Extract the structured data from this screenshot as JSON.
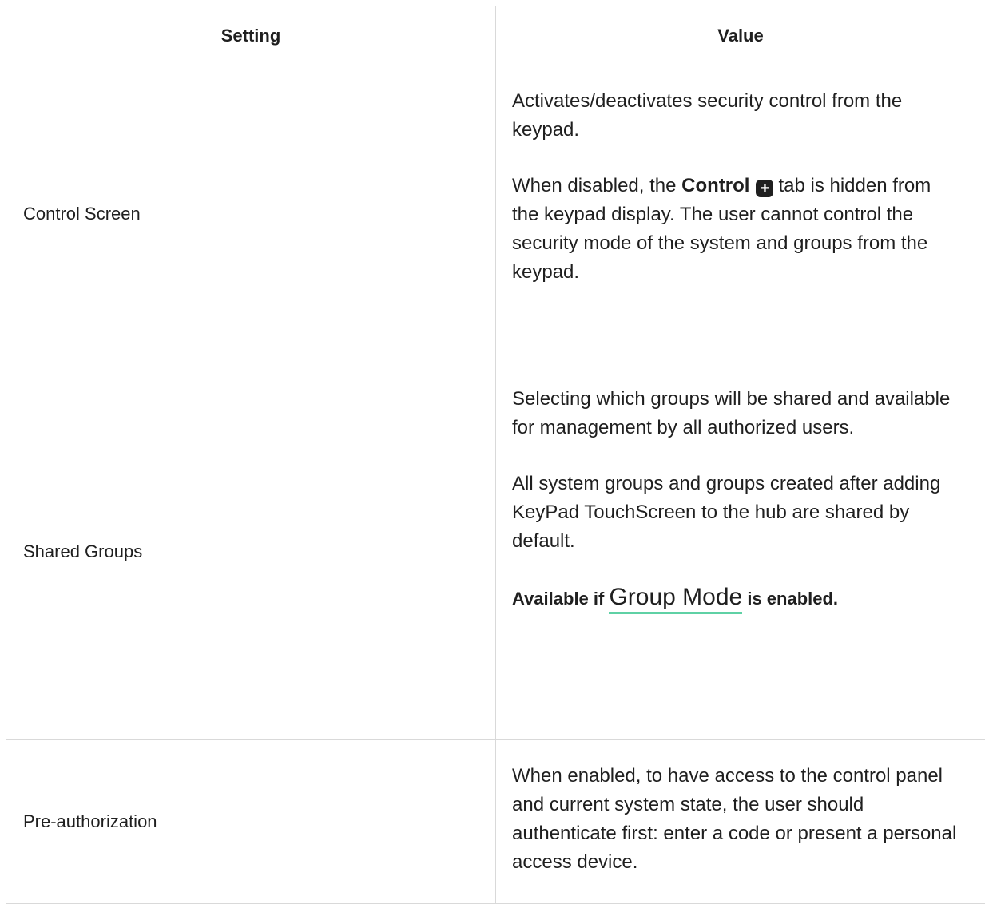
{
  "table": {
    "headers": {
      "setting": "Setting",
      "value": "Value"
    },
    "rows": [
      {
        "setting": "Control Screen",
        "p1": "Activates/deactivates security control from the keypad.",
        "p2_before": "When disabled, the ",
        "p2_bold": "Control",
        "p2_icon": "plus-icon",
        "p2_after": "tab is hidden from the keypad display. The user cannot control the security mode of the system and groups from the keypad."
      },
      {
        "setting": "Shared Groups",
        "p1": "Selecting which groups will be shared and available for management by all authorized users.",
        "p2": "All system groups and groups created after adding KeyPad TouchScreen to the hub are shared by default.",
        "note_before": "Available if ",
        "note_link": "Group Mode",
        "note_after": " is enabled.",
        "link_underline_color": "#5fd1a5"
      },
      {
        "setting": "Pre-authorization",
        "p1": "When enabled, to have access to the control panel and current system state, the user should authenticate first: enter a code or present a personal access device."
      }
    ]
  }
}
